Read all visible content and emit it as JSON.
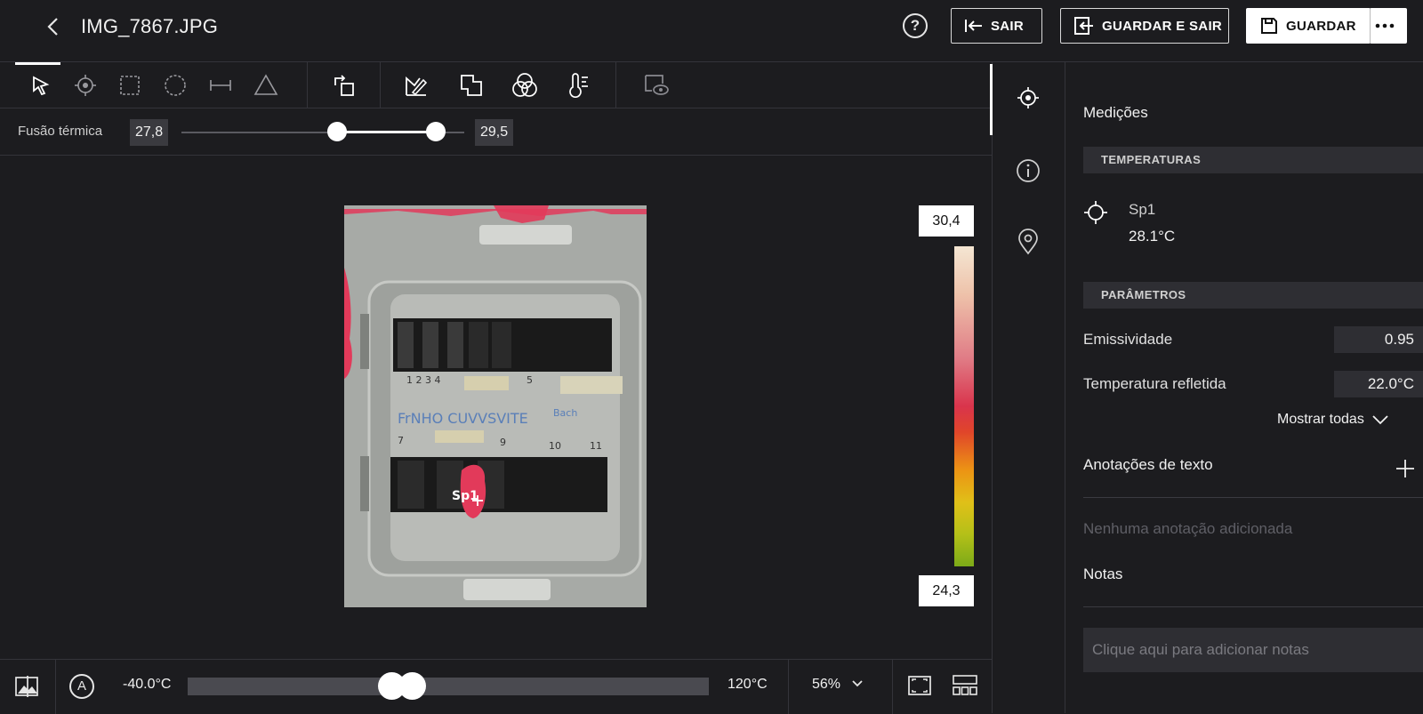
{
  "header": {
    "filename": "IMG_7867.JPG",
    "help_glyph": "?",
    "sair_label": "SAIR",
    "guardar_e_sair_label": "GUARDAR E SAIR",
    "guardar_label": "GUARDAR"
  },
  "toolbar": {
    "tools": [
      "select-tool",
      "spot-tool",
      "box-tool",
      "circle-tool",
      "line-tool",
      "delta-tool",
      "rotate-tool",
      "palette-tool",
      "layers-tool",
      "fusion-tool",
      "temperature-scale-tool",
      "visibility-tool"
    ],
    "active_tool": "select-tool"
  },
  "fusion": {
    "label": "Fusão térmica",
    "min_value": "27,8",
    "max_value": "29,5",
    "range_fraction": [
      0.55,
      0.9
    ]
  },
  "image": {
    "spot_label": "Sp1",
    "scale_max": "30,4",
    "scale_min": "24,3",
    "palette_colors": [
      "#f4e6d3",
      "#d9344c",
      "#ec9414",
      "#7caa18"
    ]
  },
  "bottom": {
    "range_min": "-40.0°C",
    "range_max": "120°C",
    "range_knobs_fraction": [
      0.39,
      0.43
    ],
    "auto_glyph": "A",
    "zoom": "56%"
  },
  "panel": {
    "title": "Medições",
    "temperatures_header": "TEMPERATURAS",
    "spot_name": "Sp1",
    "spot_temp": "28.1°C",
    "parameters_header": "PARÂMETROS",
    "emissivity_label": "Emissividade",
    "emissivity_value": "0.95",
    "reflected_label": "Temperatura refletida",
    "reflected_value": "22.0°C",
    "show_all_label": "Mostrar todas",
    "annotations_label": "Anotações de texto",
    "annotations_empty": "Nenhuma anotação adicionada",
    "notes_label": "Notas",
    "notes_placeholder": "Clique aqui para adicionar notas"
  }
}
